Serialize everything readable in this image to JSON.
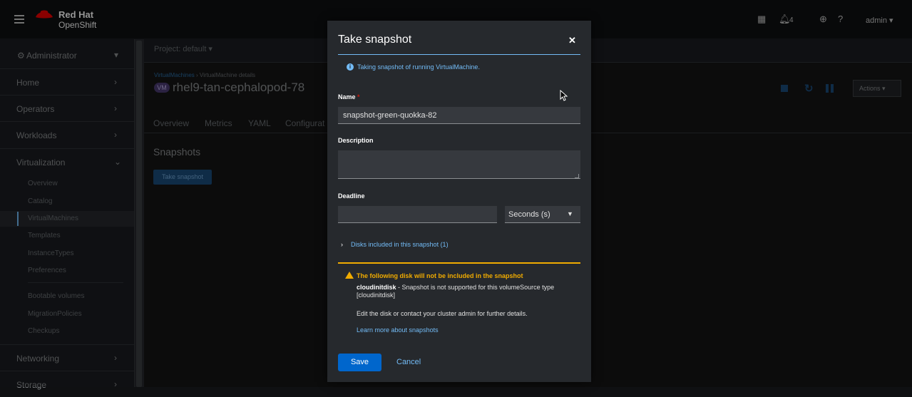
{
  "masthead": {
    "brand_line1": "Red Hat",
    "brand_line2": "OpenShift",
    "notifications_count": "4",
    "user": "admin"
  },
  "sidebar": {
    "perspective": "Administrator",
    "sections": [
      {
        "label": "Home"
      },
      {
        "label": "Operators"
      },
      {
        "label": "Workloads"
      },
      {
        "label": "Virtualization"
      },
      {
        "label": "Networking"
      },
      {
        "label": "Storage"
      }
    ],
    "virtualization_items": [
      {
        "label": "Overview"
      },
      {
        "label": "Catalog"
      },
      {
        "label": "VirtualMachines"
      },
      {
        "label": "Templates"
      },
      {
        "label": "InstanceTypes"
      },
      {
        "label": "Preferences"
      },
      {
        "label": "Bootable volumes"
      },
      {
        "label": "MigrationPolicies"
      },
      {
        "label": "Checkups"
      }
    ]
  },
  "page": {
    "project_selector": "Project: default",
    "breadcrumb_parent": "VirtualMachines",
    "breadcrumb_current": "VirtualMachine details",
    "vm_badge": "VM",
    "vm_name": "rhel9-tan-cephalopod-78",
    "tabs": [
      "Overview",
      "Metrics",
      "YAML",
      "Configurat"
    ],
    "section_title": "Snapshots",
    "take_snapshot_button": "Take snapshot",
    "actions_button": "Actions"
  },
  "modal": {
    "title": "Take snapshot",
    "info_text": "Taking snapshot of running VirtualMachine.",
    "name_label": "Name",
    "required_mark": "*",
    "name_value": "snapshot-green-quokka-82",
    "description_label": "Description",
    "description_value": "",
    "deadline_label": "Deadline",
    "deadline_value": "",
    "deadline_unit": "Seconds (s)",
    "disks_toggle": "Disks included in this snapshot (1)",
    "warning_title": "The following disk will not be included in the snapshot",
    "warning_disk": "cloudinitdisk",
    "warning_reason": " - Snapshot is not supported for this volumeSource type [cloudinitdisk]",
    "warning_help": "Edit the disk or contact your cluster admin for further details.",
    "learn_more": "Learn more about snapshots",
    "save_label": "Save",
    "cancel_label": "Cancel"
  }
}
